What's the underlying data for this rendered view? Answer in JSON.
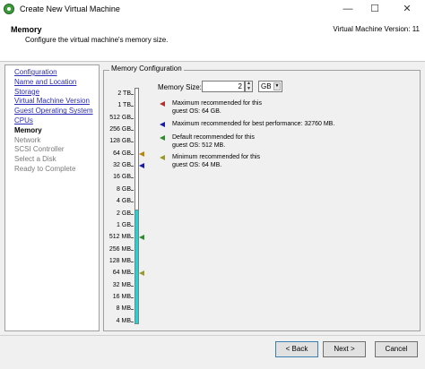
{
  "window": {
    "title": "Create New Virtual Machine",
    "controls": [
      "—",
      "☐",
      "✕"
    ]
  },
  "header": {
    "title": "Memory",
    "subtitle": "Configure the virtual machine's memory size.",
    "version": "Virtual Machine Version: 11"
  },
  "steps": [
    {
      "label": "Configuration",
      "state": "link"
    },
    {
      "label": "Name and Location",
      "state": "link"
    },
    {
      "label": "Storage",
      "state": "link"
    },
    {
      "label": "Virtual Machine Version",
      "state": "link"
    },
    {
      "label": "Guest Operating System",
      "state": "link"
    },
    {
      "label": "CPUs",
      "state": "link"
    },
    {
      "label": "Memory",
      "state": "current"
    },
    {
      "label": "Network",
      "state": "future"
    },
    {
      "label": "SCSI Controller",
      "state": "future"
    },
    {
      "label": "Select a Disk",
      "state": "future"
    },
    {
      "label": "Ready to Complete",
      "state": "future"
    }
  ],
  "memory": {
    "group_title": "Memory Configuration",
    "size_label": "Memory Size:",
    "size_value": "2",
    "unit": "GB",
    "scale": [
      "2 TB",
      "1 TB",
      "512 GB",
      "256 GB",
      "128 GB",
      "64 GB",
      "32 GB",
      "16 GB",
      "8 GB",
      "4 GB",
      "2 GB",
      "1 GB",
      "512 MB",
      "256 MB",
      "128 MB",
      "64 MB",
      "32 MB",
      "16 MB",
      "8 MB",
      "4 MB"
    ],
    "selected_level": "2 GB",
    "markers": [
      {
        "level": "64 GB",
        "color": "#b8860b"
      },
      {
        "level": "32 GB",
        "color": "#1a1aa8"
      },
      {
        "level": "512 MB",
        "color": "#2e8b2e"
      },
      {
        "level": "64 MB",
        "color": "#9a9a2a"
      }
    ],
    "legend": [
      {
        "color": "#b03030",
        "line1": "Maximum recommended for this",
        "line2": "guest OS: 64 GB."
      },
      {
        "color": "#1a1aa8",
        "line1": "Maximum recommended for best performance: 32760 MB.",
        "line2": ""
      },
      {
        "color": "#2e8b2e",
        "line1": "Default recommended for this",
        "line2": "guest OS: 512 MB."
      },
      {
        "color": "#9a9a2a",
        "line1": "Minimum recommended for this",
        "line2": "guest OS: 64 MB."
      }
    ]
  },
  "buttons": {
    "back": "< Back",
    "next": "Next >",
    "cancel": "Cancel"
  }
}
